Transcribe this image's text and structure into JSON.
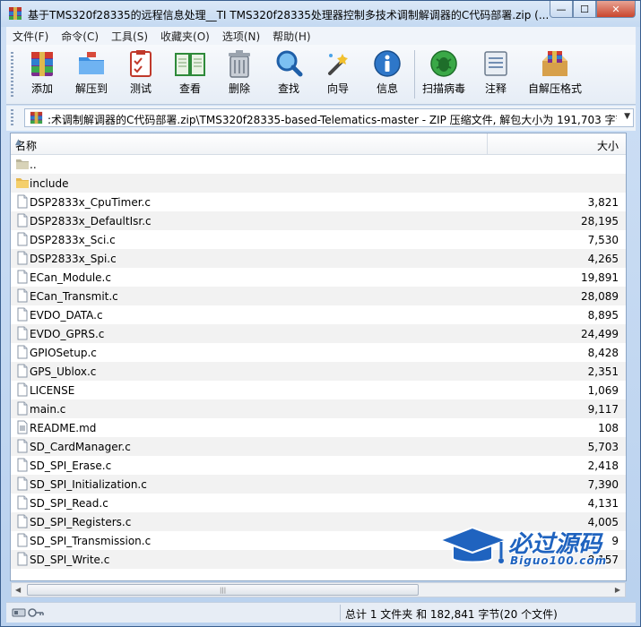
{
  "window": {
    "title": "基于TMS320f28335的远程信息处理__TI TMS320f28335处理器控制多技术调制解调器的C代码部署.zip (..."
  },
  "window_controls": {
    "minimize": "—",
    "maximize": "☐",
    "close": "✕"
  },
  "menu": [
    {
      "label": "文件(F)"
    },
    {
      "label": "命令(C)"
    },
    {
      "label": "工具(S)"
    },
    {
      "label": "收藏夹(O)"
    },
    {
      "label": "选项(N)"
    },
    {
      "label": "帮助(H)"
    }
  ],
  "toolbar": [
    {
      "label": "添加",
      "icon": "add-archive-icon"
    },
    {
      "label": "解压到",
      "icon": "extract-to-icon"
    },
    {
      "label": "测试",
      "icon": "test-icon"
    },
    {
      "label": "查看",
      "icon": "view-book-icon"
    },
    {
      "label": "删除",
      "icon": "trash-icon"
    },
    {
      "label": "查找",
      "icon": "find-magnifier-icon"
    },
    {
      "label": "向导",
      "icon": "wizard-wand-icon"
    },
    {
      "label": "信息",
      "icon": "info-icon"
    },
    {
      "label": "扫描病毒",
      "icon": "virus-scan-icon"
    },
    {
      "label": "注释",
      "icon": "comment-icon"
    },
    {
      "label": "自解压格式",
      "icon": "sfx-icon"
    }
  ],
  "address": {
    "path": ":术调制解调器的C代码部署.zip\\TMS320f28335-based-Telematics-master - ZIP 压缩文件, 解包大小为 191,703 字节"
  },
  "columns": {
    "name": "名称",
    "size": "大小"
  },
  "files": [
    {
      "name": "..",
      "size": "",
      "type": "parent"
    },
    {
      "name": "include",
      "size": "",
      "type": "folder"
    },
    {
      "name": "DSP2833x_CpuTimer.c",
      "size": "3,821",
      "type": "file"
    },
    {
      "name": "DSP2833x_DefaultIsr.c",
      "size": "28,195",
      "type": "file"
    },
    {
      "name": "DSP2833x_Sci.c",
      "size": "7,530",
      "type": "file"
    },
    {
      "name": "DSP2833x_Spi.c",
      "size": "4,265",
      "type": "file"
    },
    {
      "name": "ECan_Module.c",
      "size": "19,891",
      "type": "file"
    },
    {
      "name": "ECan_Transmit.c",
      "size": "28,089",
      "type": "file"
    },
    {
      "name": "EVDO_DATA.c",
      "size": "8,895",
      "type": "file"
    },
    {
      "name": "EVDO_GPRS.c",
      "size": "24,499",
      "type": "file"
    },
    {
      "name": "GPIOSetup.c",
      "size": "8,428",
      "type": "file"
    },
    {
      "name": "GPS_Ublox.c",
      "size": "2,351",
      "type": "file"
    },
    {
      "name": "LICENSE",
      "size": "1,069",
      "type": "file"
    },
    {
      "name": "main.c",
      "size": "9,117",
      "type": "file"
    },
    {
      "name": "README.md",
      "size": "108",
      "type": "text"
    },
    {
      "name": "SD_CardManager.c",
      "size": "5,703",
      "type": "file"
    },
    {
      "name": "SD_SPI_Erase.c",
      "size": "2,418",
      "type": "file"
    },
    {
      "name": "SD_SPI_Initialization.c",
      "size": "7,390",
      "type": "file"
    },
    {
      "name": "SD_SPI_Read.c",
      "size": "4,131",
      "type": "file"
    },
    {
      "name": "SD_SPI_Registers.c",
      "size": "4,005",
      "type": "file"
    },
    {
      "name": "SD_SPI_Transmission.c",
      "size": "9",
      "type": "file"
    },
    {
      "name": "SD_SPI_Write.c",
      "size": "8,157",
      "type": "file"
    }
  ],
  "status": {
    "text": "总计 1 文件夹 和 182,841 字节(20 个文件)"
  },
  "watermark": {
    "main": "必过源码",
    "sub": "Biguo100.com"
  },
  "colors": {
    "accent": "#1f63bf",
    "title_bar": "#c4d9f1",
    "shaded_row": "#f2f2f2"
  }
}
